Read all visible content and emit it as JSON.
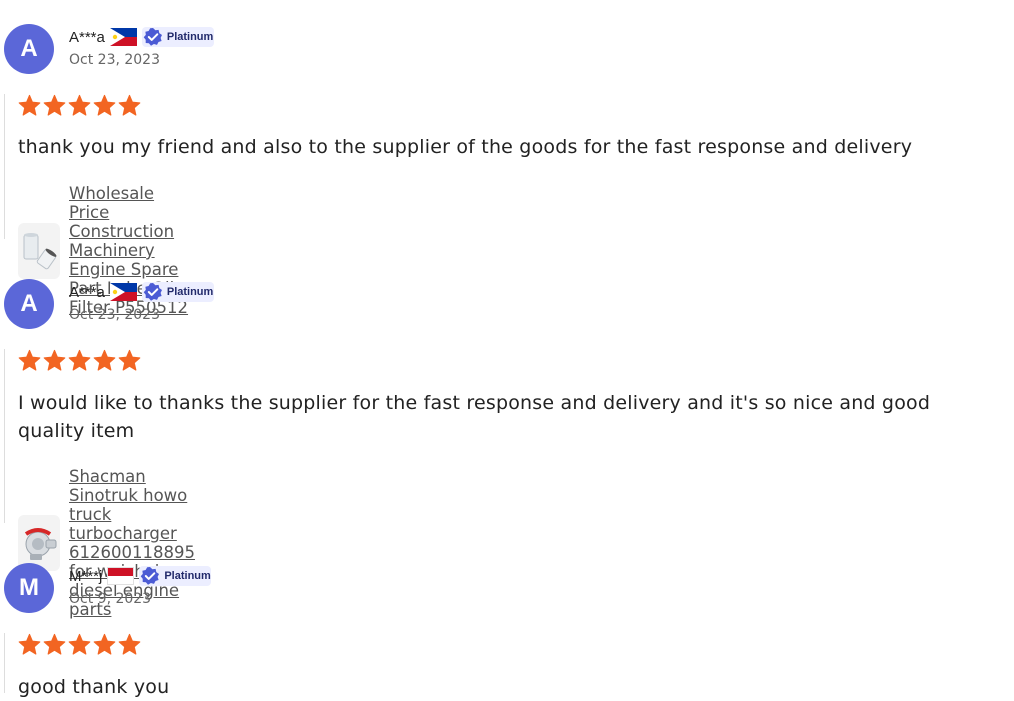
{
  "reviews": [
    {
      "avatar_letter": "A",
      "user": "A***a",
      "country": "Philippines",
      "badge": "Platinum",
      "date": "Oct 23, 2023",
      "rating": 5,
      "comment": "thank you my friend and also to the supplier of the goods for the fast response and delivery",
      "product": "Wholesale Price Construction Machinery Engine Spare Part Lube Oil Filter P550512"
    },
    {
      "avatar_letter": "A",
      "user": "A***a",
      "country": "Philippines",
      "badge": "Platinum",
      "date": "Oct 23, 2023",
      "rating": 5,
      "comment": "I would like to thanks the supplier for the fast response and delivery and it's so nice and good quality item",
      "product": "Shacman Sinotruk howo truck turbocharger 612600118895 for weichai diesel engine parts"
    },
    {
      "avatar_letter": "M",
      "user": "M***j",
      "country": "Indonesia",
      "badge": "Platinum",
      "date": "Oct 9, 2023",
      "rating": 5,
      "comment": "good thank you"
    }
  ],
  "colors": {
    "avatar": "#5b67d8",
    "star": "#f26522",
    "badge_bg": "#eceeff",
    "badge_icon": "#4b5bd4"
  },
  "icons": {
    "star": "star-icon",
    "verified": "verified-check-icon",
    "product_filter": "oil-filter-thumbnail",
    "product_turbo": "turbocharger-thumbnail"
  }
}
